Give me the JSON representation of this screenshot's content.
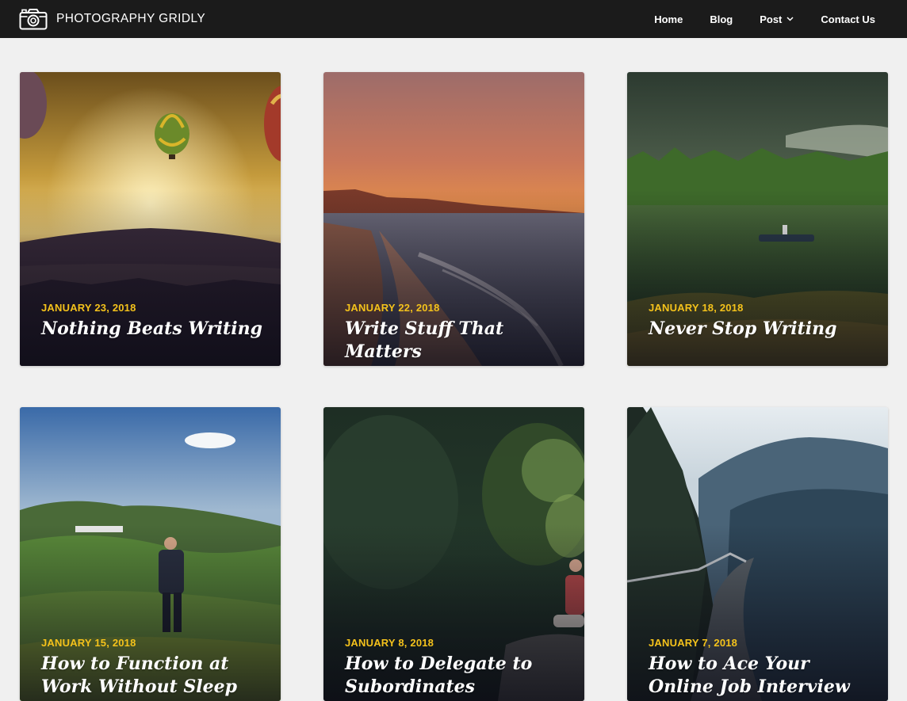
{
  "site": {
    "name": "PHOTOGRAPHY GRIDLY",
    "logo_icon": "camera-icon"
  },
  "nav": {
    "items": [
      {
        "label": "Home"
      },
      {
        "label": "Blog"
      },
      {
        "label": "Post",
        "has_dropdown": true
      },
      {
        "label": "Contact Us"
      }
    ]
  },
  "colors": {
    "topbar": "#1b1b1b",
    "background": "#f0f0f0",
    "date_accent": "#f4c21b",
    "title_text": "#ffffff"
  },
  "posts": [
    {
      "date": "JANUARY 23, 2018",
      "title": "Nothing Beats Writing"
    },
    {
      "date": "JANUARY 22, 2018",
      "title": "Write Stuff That Matters"
    },
    {
      "date": "JANUARY 18, 2018",
      "title": "Never Stop Writing"
    },
    {
      "date": "JANUARY 15, 2018",
      "title": "How to Function at Work Without Sleep"
    },
    {
      "date": "JANUARY 8, 2018",
      "title": "How to Delegate to Subordinates"
    },
    {
      "date": "JANUARY 7, 2018",
      "title": "How to Ace Your Online Job Interview"
    }
  ]
}
